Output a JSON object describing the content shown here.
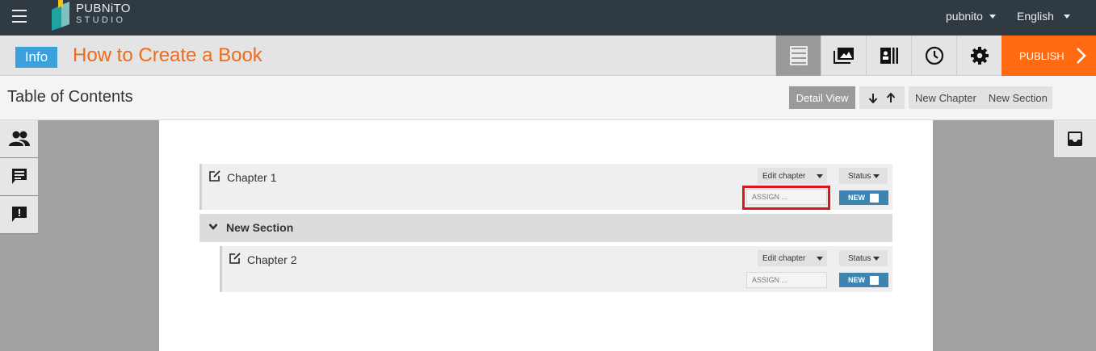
{
  "app": {
    "logo_line1": "PUBNiTO",
    "logo_line2": "STUDIO",
    "user_menu": "pubnito",
    "language_menu": "English"
  },
  "titlebar": {
    "badge": "Info",
    "book_title": "How to Create a Book",
    "publish_label": "PUBLISH",
    "tools": [
      "list-icon",
      "gallery-icon",
      "library-icon",
      "history-icon",
      "gear-icon"
    ]
  },
  "toc": {
    "title": "Table of Contents",
    "detail_view": "Detail View",
    "new_chapter": "New Chapter",
    "new_section": "New Section"
  },
  "chapters": [
    {
      "title": "Chapter 1",
      "edit_label": "Edit chapter",
      "status_label": "Status",
      "assign_placeholder": "ASSIGN ...",
      "state_label": "NEW"
    },
    {
      "title": "Chapter 2",
      "edit_label": "Edit chapter",
      "status_label": "Status",
      "assign_placeholder": "ASSIGN ...",
      "state_label": "NEW"
    }
  ],
  "section": {
    "title": "New Section"
  },
  "colors": {
    "navbar": "#2f3a42",
    "accent_orange": "#ff6a13",
    "info_blue": "#3ca0dc",
    "new_tag": "#3d84b0",
    "highlight_red": "#d9161e"
  }
}
